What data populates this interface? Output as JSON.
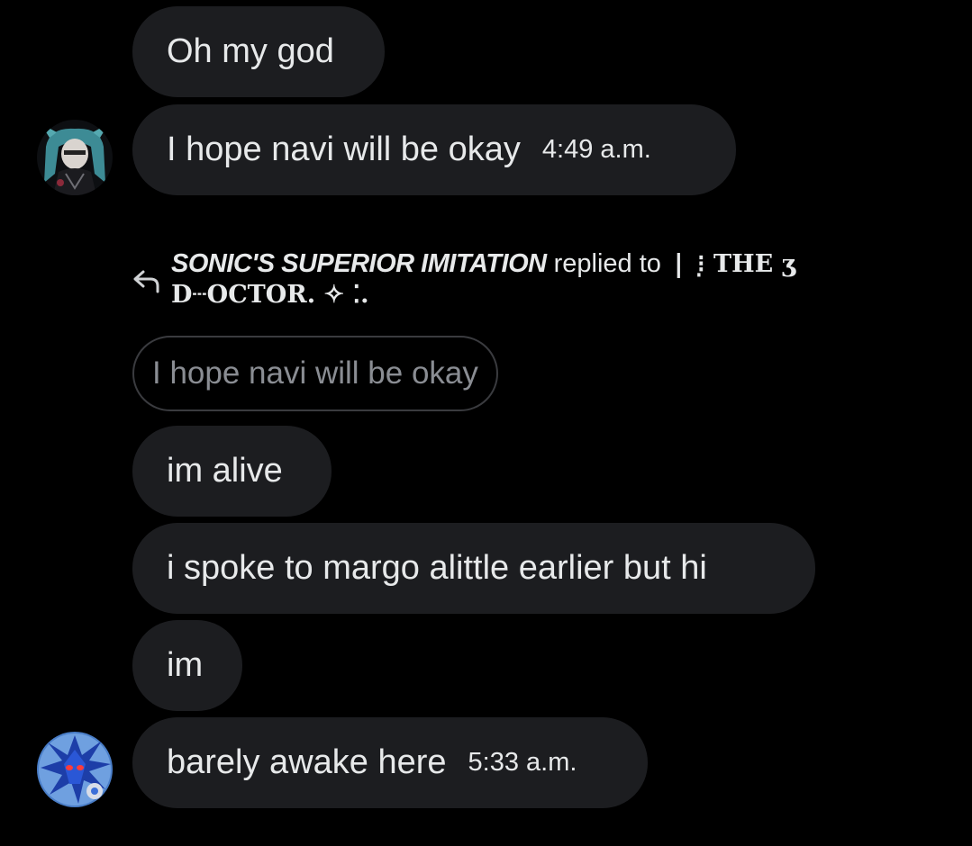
{
  "messages_top": [
    {
      "text": "Oh my god"
    },
    {
      "text": "I hope navi will be okay",
      "time": "4:49 a.m."
    }
  ],
  "avatars": {
    "first_sender": "avatar-anime-girl-teal-hair",
    "second_sender": "avatar-blue-robot-hedgehog"
  },
  "reply": {
    "icon": "reply-arrow-icon",
    "sender": "SONIC'S SUPERIOR IMITATION",
    "verb": "replied to",
    "target_line1": "❘ ⁝̣ THE ʒ",
    "target_line2": "D┄OCTOR. ✧ ⁚.",
    "quoted_text": "I hope navi will be okay"
  },
  "messages_bottom": [
    {
      "text": "im alive"
    },
    {
      "text": "i spoke to margo alittle earlier but hi"
    },
    {
      "text": "im"
    },
    {
      "text": "barely awake here",
      "time": "5:33 a.m."
    }
  ],
  "colors": {
    "background": "#000000",
    "bubble": "#1c1d20",
    "text": "#e7e9ea",
    "quoted_text": "#8a8d93",
    "quoted_border": "#3a3b3f"
  }
}
